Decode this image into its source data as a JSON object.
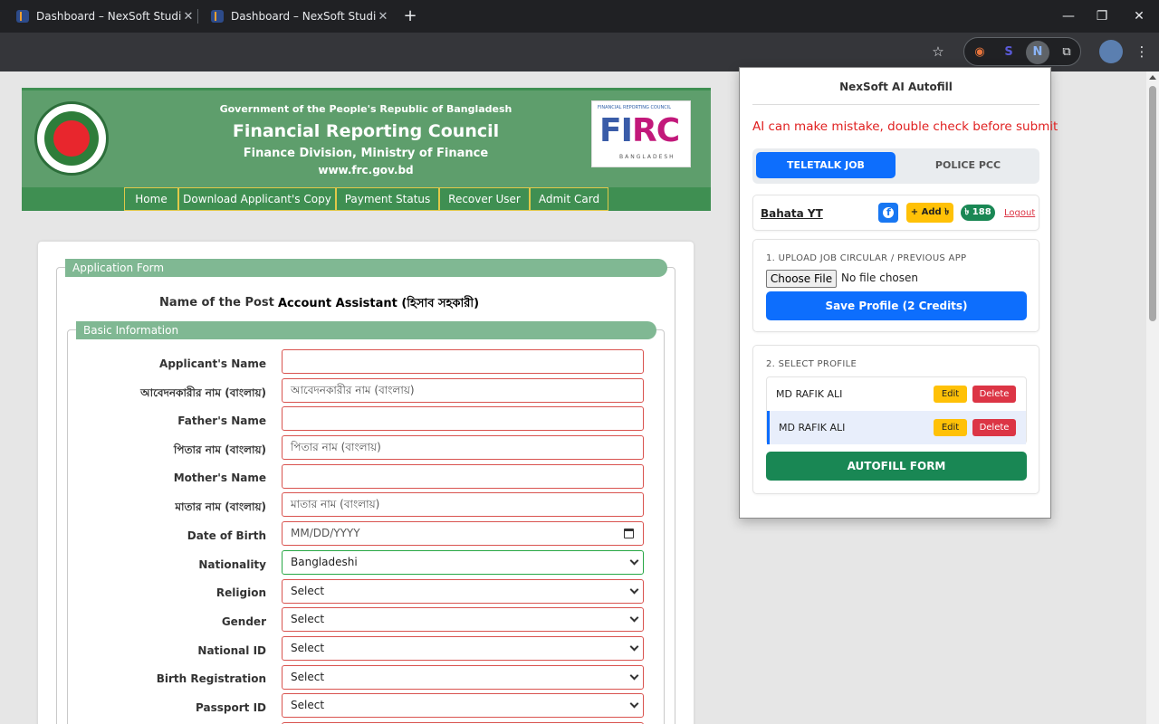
{
  "browser": {
    "tabs": [
      {
        "title": "Dashboard – NexSoft Studio"
      },
      {
        "title": "Dashboard – NexSoft Studio"
      }
    ],
    "tab_close": "✕",
    "new_tab": "+",
    "window_controls": {
      "minimize": "—",
      "restore": "❐",
      "close": "✕"
    },
    "toolbar_icons": [
      "star-icon",
      "extensions-icon",
      "profile-icon",
      "menu-icon"
    ],
    "extensions": [
      {
        "name": "extension-1-icon",
        "glyph": "◉"
      },
      {
        "name": "extension-2-icon",
        "glyph": "S"
      },
      {
        "name": "nexsoft-extension-icon",
        "glyph": "N"
      }
    ]
  },
  "site": {
    "header": {
      "line1": "Government of the People's Republic of Bangladesh",
      "line2": "Financial Reporting Council",
      "line3": "Finance Division, Ministry of Finance",
      "line4": "www.frc.gov.bd"
    },
    "logo": {
      "small": "FINANCIAL REPORTING COUNCIL",
      "fi": "FI",
      "rc": "RC",
      "sub": "BANGLADESH"
    },
    "nav": [
      "Home",
      "Download Applicant's Copy",
      "Payment Status",
      "Recover User",
      "Admit Card"
    ],
    "form": {
      "legend_application": "Application Form",
      "post_label": "Name of the Post",
      "post_value": "Account Assistant (হিসাব সহকারী)",
      "legend_basic": "Basic Information",
      "rows": [
        {
          "label": "Applicant's Name",
          "value": ""
        },
        {
          "label": "আবেদনকারীর নাম (বাংলায়)",
          "value": "আবেদনকারীর নাম (বাংলায়)"
        },
        {
          "label": "Father's Name",
          "value": ""
        },
        {
          "label": "পিতার নাম (বাংলায়)",
          "value": "পিতার নাম (বাংলায়)"
        },
        {
          "label": "Mother's Name",
          "value": ""
        },
        {
          "label": "মাতার নাম (বাংলায়)",
          "value": "মাতার নাম (বাংলায়)"
        },
        {
          "label": "Date of Birth",
          "value": "MM/DD/YYYY"
        },
        {
          "label": "Nationality",
          "value": "Bangladeshi"
        },
        {
          "label": "Religion",
          "value": "Select"
        },
        {
          "label": "Gender",
          "value": "Select"
        },
        {
          "label": "National ID",
          "value": "Select"
        },
        {
          "label": "Birth Registration",
          "value": "Select"
        },
        {
          "label": "Passport ID",
          "value": "Select"
        }
      ]
    }
  },
  "popup": {
    "title": "NexSoft AI Autofill",
    "warning": "AI can make mistake, double check before submit",
    "tabs": {
      "active": "TELETALK JOB",
      "inactive": "POLICE PCC"
    },
    "user": {
      "name": "Bahata YT",
      "fb": "f",
      "add": "+ Add ৳",
      "credits": "৳ 188",
      "logout": "Logout"
    },
    "upload": {
      "title": "1. UPLOAD JOB CIRCULAR / PREVIOUS APP",
      "choose": "Choose File",
      "none": "No file chosen",
      "save": "Save Profile (2 Credits)"
    },
    "profiles": {
      "title": "2. SELECT PROFILE",
      "items": [
        {
          "name": "MD RAFIK ALI",
          "edit": "Edit",
          "delete": "Delete"
        },
        {
          "name": "MD RAFIK ALI",
          "edit": "Edit",
          "delete": "Delete"
        }
      ],
      "autofill": "AUTOFILL FORM"
    }
  }
}
